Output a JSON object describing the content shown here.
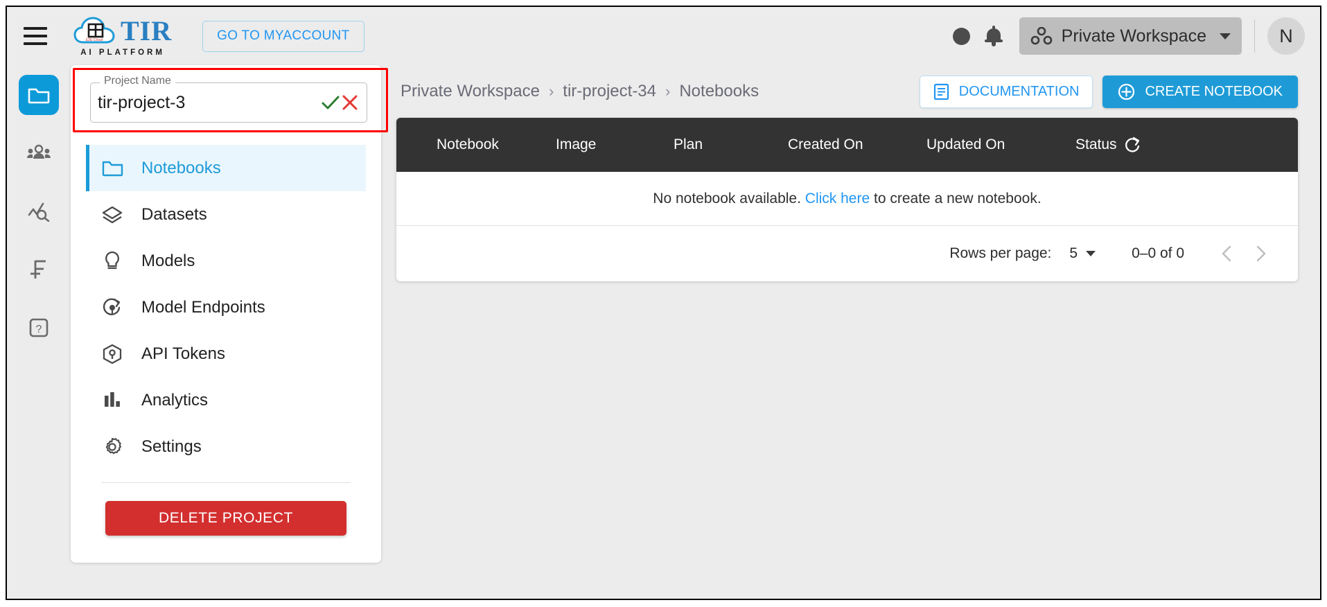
{
  "topbar": {
    "menu_icon": "hamburger-icon",
    "brand_name": "TIR",
    "brand_subtitle": "AI PLATFORM",
    "brand_logo_text": "E2E Cloud",
    "myaccount_label": "GO TO MYACCOUNT",
    "theme_toggle_icon": "moon-icon",
    "notifications_icon": "bell-icon",
    "workspace_label": "Private Workspace",
    "workspace_icon": "workspace-group-icon",
    "avatar_initial": "N"
  },
  "rail": {
    "items": [
      {
        "icon": "folder-icon",
        "name": "rail-item-projects",
        "active": true
      },
      {
        "icon": "people-icon",
        "name": "rail-item-team",
        "active": false
      },
      {
        "icon": "monitoring-icon",
        "name": "rail-item-monitoring",
        "active": false
      },
      {
        "icon": "billing-icon",
        "name": "rail-item-billing",
        "active": false
      },
      {
        "icon": "help-icon",
        "name": "rail-item-help",
        "active": false
      }
    ]
  },
  "project_panel": {
    "name_legend": "Project Name",
    "name_value": "tir-project-3",
    "name_placeholder": "Project Name",
    "confirm_icon": "check-icon",
    "cancel_icon": "close-icon",
    "menu": [
      {
        "label": "Notebooks",
        "icon": "folder-icon",
        "active": true
      },
      {
        "label": "Datasets",
        "icon": "layers-icon",
        "active": false
      },
      {
        "label": "Models",
        "icon": "lightbulb-icon",
        "active": false
      },
      {
        "label": "Model Endpoints",
        "icon": "endpoint-refresh-icon",
        "active": false
      },
      {
        "label": "API Tokens",
        "icon": "cube-icon",
        "active": false
      },
      {
        "label": "Analytics",
        "icon": "bar-chart-icon",
        "active": false
      },
      {
        "label": "Settings",
        "icon": "gear-icon",
        "active": false
      }
    ],
    "delete_label": "DELETE PROJECT"
  },
  "breadcrumb": {
    "items": [
      "Private Workspace",
      "tir-project-34",
      "Notebooks"
    ],
    "separator": "›"
  },
  "actions": {
    "documentation_label": "DOCUMENTATION",
    "documentation_icon": "article-icon",
    "create_label": "CREATE NOTEBOOK",
    "create_icon": "plus-circle-icon"
  },
  "table": {
    "columns": [
      "Notebook",
      "Image",
      "Plan",
      "Created On",
      "Updated On",
      "Status"
    ],
    "refresh_icon": "refresh-icon",
    "rows": [],
    "empty_text_before": "No notebook available.",
    "empty_link": "Click here",
    "empty_text_after": "to create a new notebook."
  },
  "pagination": {
    "rows_per_page_label": "Rows per page:",
    "rows_per_page_value": "5",
    "range_label": "0–0 of 0",
    "prev_icon": "chevron-left-icon",
    "next_icon": "chevron-right-icon"
  },
  "colors": {
    "accent_blue": "#1e9bd7",
    "link_blue": "#2196f3",
    "danger_red": "#d32f2f",
    "highlight_red": "#ff0000",
    "header_dark": "#333333"
  }
}
